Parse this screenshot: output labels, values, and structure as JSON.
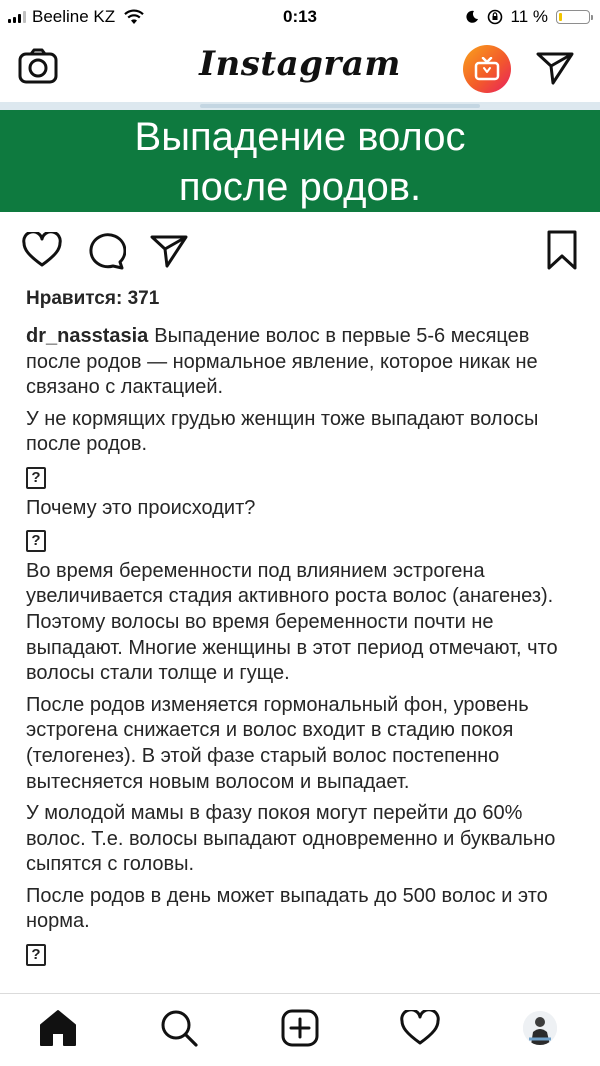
{
  "status_bar": {
    "carrier": "Beeline KZ",
    "time": "0:13",
    "battery_text": "11 %",
    "battery_level": 0.11
  },
  "header": {
    "logo": "Instagram",
    "icons": [
      "camera-icon",
      "igtv-icon",
      "direct-message-icon"
    ]
  },
  "post": {
    "image_title_line1": "Выпадение волос",
    "image_title_line2": "после родов.",
    "likes": "Нравится: 371",
    "username": "dr_nasstasia",
    "caption": [
      "Выпадение волос в первые 5-6 месяцев после родов — нормальное явление, которое никак не связано с лактацией.",
      "У не кормящих грудью женщин тоже выпадают волосы после родов.",
      "?",
      "Почему это происходит?",
      "?",
      "Во время беременности под влиянием эстрогена увеличивается стадия активного роста волос (анагенез). Поэтому волосы во время беременности почти не выпадают. Многие женщины в этот период отмечают, что волосы стали толще и гуще.",
      "После родов изменяется гормональный фон, уровень эстрогена снижается и волос входит в стадию покоя (телогенез). В этой фазе старый волос постепенно вытесняется новым волосом и выпадает.",
      "У молодой мамы в фазу покоя могут перейти до 60% волос. Т.е. волосы выпадают одновременно и буквально сыпятся с головы.",
      "После родов в день может выпадать до 500 волос и это норма.",
      "?"
    ]
  },
  "tabbar": {
    "icons": [
      "home-icon",
      "search-icon",
      "new-post-icon",
      "activity-heart-icon",
      "profile-avatar"
    ]
  },
  "colors": {
    "image_green": "#0e7a3f",
    "battery_yellow": "#f2c500",
    "igtv_gradient": [
      "#f9a31c",
      "#e8205e"
    ]
  }
}
